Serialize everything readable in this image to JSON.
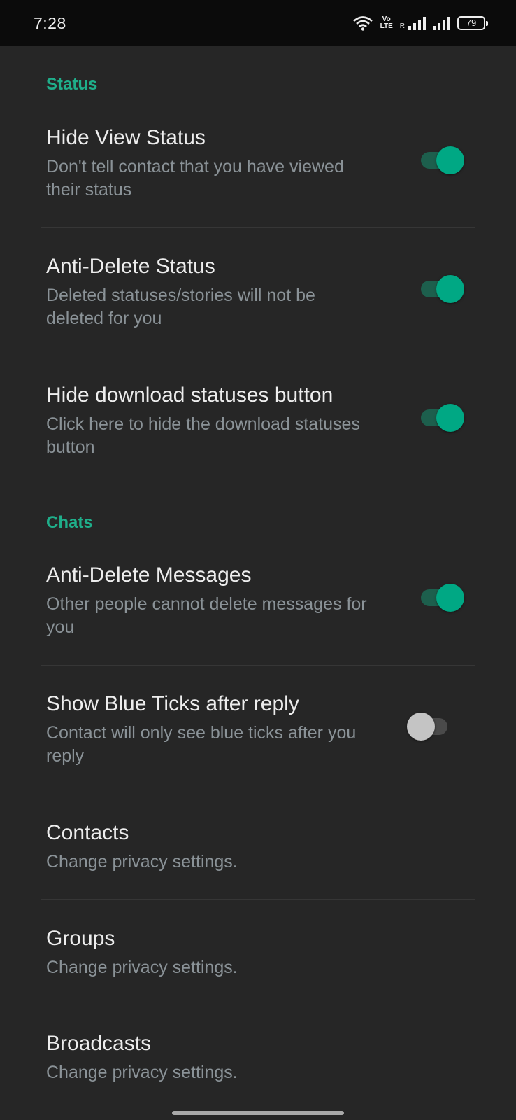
{
  "status_bar": {
    "time": "7:28",
    "volte_line1": "Vo",
    "volte_line2": "LTE",
    "roaming": "R",
    "battery": "79",
    "icons": [
      "wifi-icon",
      "volte-icon",
      "signal-icon",
      "signal-icon",
      "battery-icon"
    ]
  },
  "sections": {
    "status": "Status",
    "chats": "Chats"
  },
  "settings": [
    {
      "title": "Hide View Status",
      "subtitle": "Don't tell contact that you have viewed their status",
      "toggle": true
    },
    {
      "title": "Anti-Delete Status",
      "subtitle": "Deleted statuses/stories will not be deleted for you",
      "toggle": true
    },
    {
      "title": "Hide download statuses button",
      "subtitle": "Click here to hide the download statuses button",
      "toggle": true
    },
    {
      "title": "Anti-Delete Messages",
      "subtitle": "Other people cannot delete messages for you",
      "toggle": true
    },
    {
      "title": "Show Blue Ticks after reply",
      "subtitle": "Contact will only see blue ticks after you reply",
      "toggle": false
    },
    {
      "title": "Contacts",
      "subtitle": "Change privacy settings."
    },
    {
      "title": "Groups",
      "subtitle": "Change privacy settings."
    },
    {
      "title": "Broadcasts",
      "subtitle": "Change privacy settings."
    }
  ],
  "colors": {
    "accent": "#00a884",
    "section_header": "#1fae8a",
    "background": "#262626",
    "subtitle": "#8a9297"
  }
}
